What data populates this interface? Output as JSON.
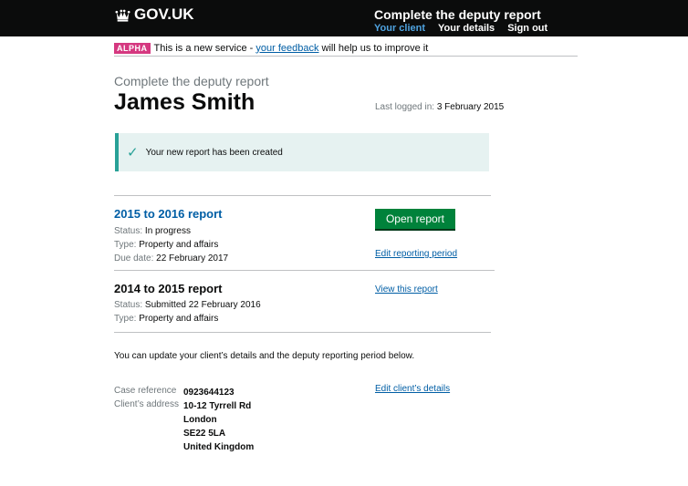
{
  "header": {
    "logo_text": "GOV.UK",
    "service_name": "Complete the deputy report",
    "nav": [
      {
        "label": "Your client",
        "active": true
      },
      {
        "label": "Your details",
        "active": false
      },
      {
        "label": "Sign out",
        "active": false
      }
    ]
  },
  "phase_banner": {
    "tag": "ALPHA",
    "text_before": "This is a new service - ",
    "link": "your feedback",
    "text_after": " will help us to improve it"
  },
  "page": {
    "caption": "Complete the deputy report",
    "title": "James Smith",
    "last_logged_label": "Last logged in:",
    "last_logged_value": "3 February 2015"
  },
  "notice": {
    "text": "Your new report has been created"
  },
  "reports": [
    {
      "title": "2015 to 2016 report",
      "status_label": "Status:",
      "status": "In progress",
      "type_label": "Type:",
      "type": "Property and affairs",
      "due_label": "Due date:",
      "due": "22 February 2017",
      "button": "Open report",
      "edit_link": "Edit reporting period"
    },
    {
      "title": "2014 to 2015 report",
      "status_label": "Status:",
      "status": "Submitted 22 February 2016",
      "type_label": "Type:",
      "type": "Property and affairs",
      "view_link": "View this report"
    }
  ],
  "client": {
    "intro": "You can update your client’s details and the deputy reporting period below.",
    "case_ref_label": "Case reference",
    "case_ref": "0923644123",
    "address_label": "Client’s address",
    "address": [
      "10-12 Tyrrell Rd",
      "London",
      "SE22 5LA",
      "United Kingdom"
    ],
    "edit_link": "Edit client’s details"
  },
  "colors": {
    "header_bg": "#0b0c0c",
    "link": "#005ea5",
    "button": "#00823b",
    "notice_border": "#28a197",
    "alpha_tag": "#d53880"
  }
}
